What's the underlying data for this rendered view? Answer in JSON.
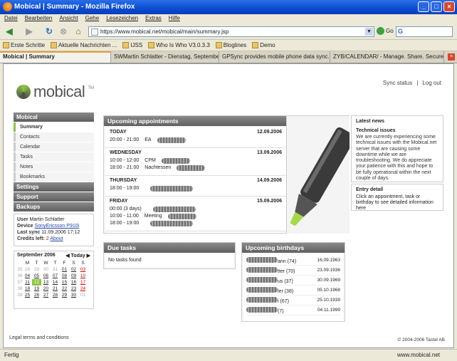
{
  "window": {
    "title": "Mobical | Summary - Mozilla Firefox"
  },
  "menu": [
    "Datei",
    "Bearbeiten",
    "Ansicht",
    "Gehe",
    "Lesezeichen",
    "Extras",
    "Hilfe"
  ],
  "url": "https://www.mobical.net/mobical/main/summary.jsp",
  "go_label": "Go",
  "bookmarks": [
    "Erste Schritte",
    "Aktuelle Nachrichten ...",
    "IJSS",
    "Who Is Who V3.0.3.3",
    "Bloglines",
    "Demo"
  ],
  "tabs": [
    "Mobical | Summary",
    "SWMartin Schlatter - Dienstag, September 12 ...",
    "GPSync provides mobile phone data sync...",
    "ZYB/CALENDAR/ - Manage. Share. Secure."
  ],
  "logo": {
    "text": "mobical",
    "tm": "TM"
  },
  "toplinks": {
    "sync": "Sync status",
    "sep": "|",
    "logout": "Log out"
  },
  "sidenav": {
    "mobical": "Mobical",
    "items": [
      "Summary",
      "Contacts",
      "Calendar",
      "Tasks",
      "Notes",
      "Bookmarks"
    ],
    "settings": "Settings",
    "support": "Support",
    "backups": "Backups"
  },
  "user": {
    "user_label": "User",
    "user": "Martin Schlatter",
    "device_label": "Device",
    "device": "SonyEricsson P910i",
    "sync_label": "Last sync",
    "sync": "11.09.2006 17:12",
    "credits_label": "Credits left:",
    "credits": "2",
    "about": "About"
  },
  "calendar": {
    "month": "September 2006",
    "today": "Today",
    "days": [
      "M",
      "T",
      "W",
      "T",
      "F",
      "S",
      "S"
    ],
    "weeks": [
      {
        "wk": "35",
        "d": [
          "28",
          "29",
          "30",
          "31",
          "01",
          "02",
          "03"
        ]
      },
      {
        "wk": "36",
        "d": [
          "04",
          "05",
          "06",
          "07",
          "08",
          "09",
          "10"
        ]
      },
      {
        "wk": "37",
        "d": [
          "11",
          "12",
          "13",
          "14",
          "15",
          "16",
          "17"
        ]
      },
      {
        "wk": "38",
        "d": [
          "18",
          "19",
          "20",
          "21",
          "22",
          "23",
          "24"
        ]
      },
      {
        "wk": "39",
        "d": [
          "25",
          "26",
          "27",
          "28",
          "29",
          "30",
          "01"
        ]
      }
    ]
  },
  "appointments": {
    "title": "Upcoming appointments",
    "days": [
      {
        "label": "TODAY",
        "date": "12.09.2006",
        "events": [
          {
            "time": "20:00 - 21:00",
            "text": "EA"
          }
        ]
      },
      {
        "label": "WEDNESDAY",
        "date": "13.09.2006",
        "events": [
          {
            "time": "10:00 - 12:00",
            "text": "CPM"
          },
          {
            "time": "18:00 - 21:00",
            "text": "Nachtessen"
          }
        ]
      },
      {
        "label": "THURSDAY",
        "date": "14.09.2006",
        "events": [
          {
            "time": "18:00 - 19:00",
            "text": ""
          }
        ]
      },
      {
        "label": "FRIDAY",
        "date": "15.09.2006",
        "events": [
          {
            "time": "00:00 (3 days)",
            "text": ""
          },
          {
            "time": "10:00 - 11:00",
            "text": "Meeting"
          },
          {
            "time": "18:00 - 19:00",
            "text": ""
          }
        ]
      }
    ]
  },
  "news": {
    "title": "Latest news",
    "subtitle": "Technical issues",
    "body": "We are currently experiencing some technical issues with the Mobical.net server that are causing some downtime while we are troubleshooting. We do appreciate your patience with this and hope to be fully operational within the next couple of days."
  },
  "entry": {
    "title": "Entry detail",
    "body": "Click an appointment, task or birthday to see detailed information here"
  },
  "due": {
    "title": "Due tasks",
    "empty": "No tasks found"
  },
  "birthdays": {
    "title": "Upcoming birthdays",
    "items": [
      {
        "name": "ann (74)",
        "date": "16.09.1963"
      },
      {
        "name": "tter (70)",
        "date": "23.09.1936"
      },
      {
        "name": "us (37)",
        "date": "30.09.1969"
      },
      {
        "name": "ler (38)",
        "date": "05.10.1968"
      },
      {
        "name": "i (67)",
        "date": "25.10.1939"
      },
      {
        "name": "(7)",
        "date": "04.11.1999"
      }
    ]
  },
  "footer": {
    "legal": "Legal terms and conditions",
    "copyright": "© 2004-2006 Tactel AB"
  },
  "status": {
    "left": "Fertig",
    "right": "www.mobical.net"
  },
  "colors": {
    "accent": "#8dc63f",
    "header": "#6b6b6b",
    "titlebar": "#0a4cd0"
  }
}
